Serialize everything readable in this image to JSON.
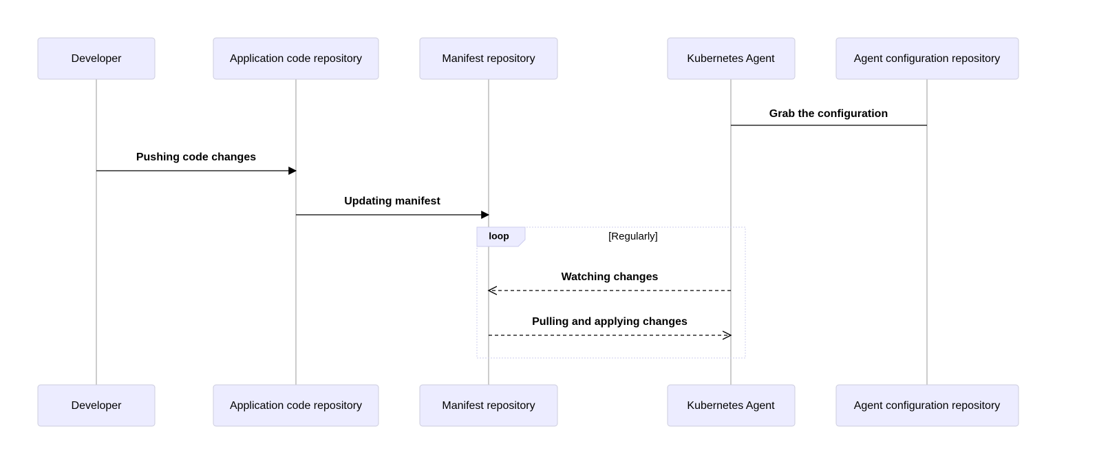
{
  "participants": {
    "developer": "Developer",
    "app_repo": "Application code repository",
    "manifest_repo": "Manifest repository",
    "k8s_agent": "Kubernetes Agent",
    "agent_config_repo": "Agent configuration repository"
  },
  "messages": {
    "grab_config": "Grab the configuration",
    "pushing_code": "Pushing code changes",
    "updating_manifest": "Updating manifest",
    "watching_changes": "Watching changes",
    "pulling_applying": "Pulling and applying changes"
  },
  "loop": {
    "keyword": "loop",
    "condition": "[Regularly]"
  }
}
